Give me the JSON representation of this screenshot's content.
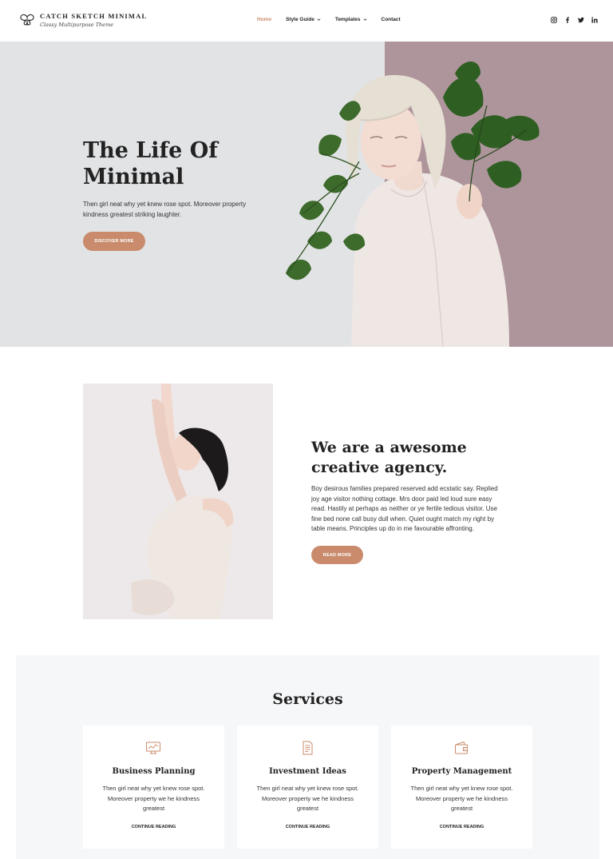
{
  "header": {
    "site_title": "Catch Sketch Minimal",
    "tagline": "Classy Multipurpose Theme",
    "nav": [
      {
        "label": "Home",
        "active": true
      },
      {
        "label": "Style Guide",
        "dropdown": true
      },
      {
        "label": "Templates",
        "dropdown": true
      },
      {
        "label": "Contact"
      }
    ],
    "social_icons": [
      "instagram-icon",
      "facebook-icon",
      "twitter-icon",
      "linkedin-icon"
    ]
  },
  "hero": {
    "title": "The Life Of Minimal",
    "text": "Then girl neat why yet knew rose spot. Moreover property kindness greatest striking laughter.",
    "button": "Discover More"
  },
  "about": {
    "title": "We are a awesome creative agency.",
    "text": "Boy desirous families prepared reserved add ecstatic say. Replied joy age visitor nothing cottage. Mrs door paid led loud sure easy read. Hastily at perhaps as neither or ye fertile tedious visitor. Use fine bed none call busy dull when. Quiet ought match my right by table means. Principles up do in me favourable affronting.",
    "button": "Read More"
  },
  "services": {
    "title": "Services",
    "cards": [
      {
        "icon": "monitor-chart-icon",
        "title": "Business Planning",
        "text": "Then girl neat why yet knew rose spot. Moreover property we he kindness greatest",
        "link": "Continue Reading"
      },
      {
        "icon": "document-icon",
        "title": "Investment Ideas",
        "text": "Then girl neat why yet knew rose spot. Moreover property we he kindness greatest",
        "link": "Continue Reading"
      },
      {
        "icon": "wallet-icon",
        "title": "Property Management",
        "text": "Then girl neat why yet knew rose spot. Moreover property we he kindness greatest",
        "link": "Continue Reading"
      }
    ]
  },
  "colors": {
    "accent": "#c98b6c",
    "hero_bg": "#e2e3e5",
    "hero_panel": "#ad959b",
    "services_bg": "#f6f7f9"
  }
}
